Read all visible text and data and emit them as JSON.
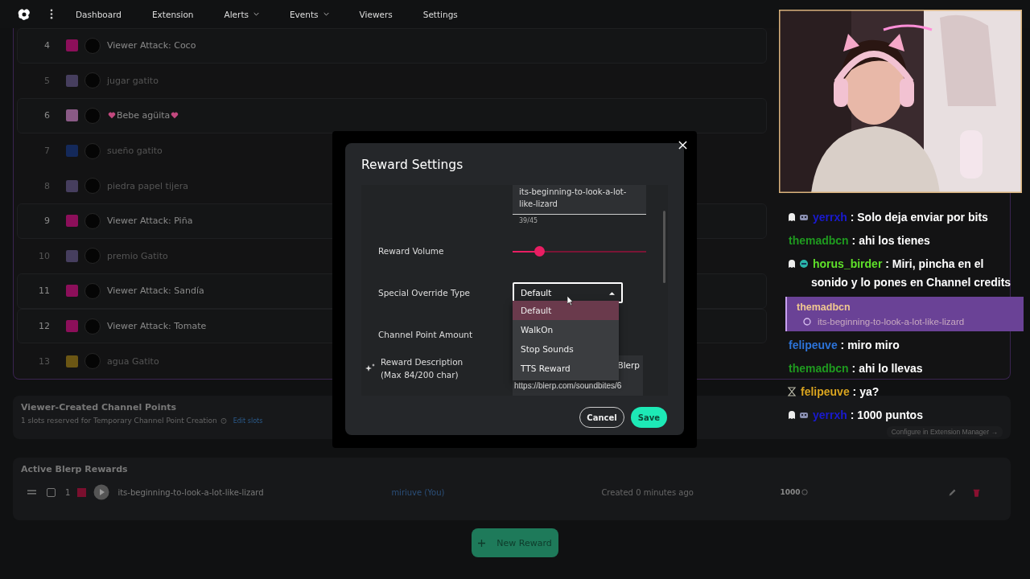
{
  "nav": {
    "items": [
      {
        "label": "Dashboard",
        "dropdown": false
      },
      {
        "label": "Extension",
        "dropdown": false
      },
      {
        "label": "Alerts",
        "dropdown": true
      },
      {
        "label": "Events",
        "dropdown": true
      },
      {
        "label": "Viewers",
        "dropdown": false
      },
      {
        "label": "Settings",
        "dropdown": false
      }
    ]
  },
  "rewards_list": {
    "rows": [
      {
        "number": "4",
        "title": "Viewer Attack: Coco",
        "color": "#8c0f5a",
        "enabled": true,
        "hearts": false
      },
      {
        "number": "5",
        "title": "jugar gatito",
        "color": "#463e5e",
        "enabled": false,
        "hearts": false
      },
      {
        "number": "6",
        "title": "Bebe agüita",
        "color": "#8a5a86",
        "enabled": true,
        "hearts": true
      },
      {
        "number": "7",
        "title": "sueño gatito",
        "color": "#14295a",
        "enabled": false,
        "hearts": false
      },
      {
        "number": "8",
        "title": "piedra papel tijera",
        "color": "#463e5e",
        "enabled": false,
        "hearts": false
      },
      {
        "number": "9",
        "title": "Viewer Attack: Piña",
        "color": "#8c0f5a",
        "enabled": true,
        "hearts": false
      },
      {
        "number": "10",
        "title": "premio Gatito",
        "color": "#463e5e",
        "enabled": false,
        "hearts": false
      },
      {
        "number": "11",
        "title": "Viewer Attack: Sandía",
        "color": "#8c0f5a",
        "enabled": true,
        "hearts": false
      },
      {
        "number": "12",
        "title": "Viewer Attack: Tomate",
        "color": "#8c0f5a",
        "enabled": true,
        "hearts": false
      },
      {
        "number": "13",
        "title": "agua Gatito",
        "color": "#6b5614",
        "enabled": false,
        "hearts": false
      }
    ]
  },
  "viewer_created": {
    "title": "Viewer-Created Channel Points",
    "description": "1 slots reserved for Temporary Channel Point Creation",
    "link": "Edit slots",
    "configure": "Configure in Extension Manager →"
  },
  "active_rewards": {
    "title": "Active Blerp Rewards",
    "rows": [
      {
        "number": "1",
        "checked": false,
        "color": "#7a0f2e",
        "title": "its-beginning-to-look-a-lot-like-lizard",
        "creator": "miriuve (You)",
        "created": "Created 0 minutes ago",
        "points": "1000"
      }
    ]
  },
  "new_reward_button": "New Reward",
  "modal": {
    "title": "Reward Settings",
    "title_value": "its-beginning-to-look-a-lot-like-lizard",
    "counter": "39/45",
    "volume_label": "Reward Volume",
    "volume": {
      "level": 0.2
    },
    "override_label": "Special Override Type",
    "override_value": "Default",
    "override_options": [
      {
        "label": "Default",
        "selected": true
      },
      {
        "label": "WalkOn",
        "selected": false
      },
      {
        "label": "Stop Sounds",
        "selected": false
      },
      {
        "label": "TTS Reward",
        "selected": false
      }
    ],
    "points_label": "Channel Point Amount",
    "description_label": "Reward Description (Max 84/200 char)",
    "description_visible": "Blerp",
    "description_url": "https://blerp.com/soundbites/6",
    "cancel": "Cancel",
    "save": "Save"
  },
  "chat": {
    "messages": [
      {
        "kind": "mod",
        "user": "yerrxh",
        "color": "#1a1ad0",
        "text": ": Solo deja enviar por bits"
      },
      {
        "kind": "plain",
        "user": "themadbcn",
        "color": "#1f9a1f",
        "text": ": ahi los tienes"
      },
      {
        "kind": "sub",
        "user": "horus_birder",
        "color": "#5fe02a",
        "text": ": Miri, pincha en el sonido y lo pones en Channel credits"
      },
      {
        "kind": "redemption",
        "user": "themadbcn",
        "color": "#f0c890",
        "text": "its-beginning-to-look-a-lot-like-lizard"
      },
      {
        "kind": "plain",
        "user": "felipeuve",
        "color": "#2c73d8",
        "text": ": miro miro"
      },
      {
        "kind": "plain",
        "user": "themadbcn",
        "color": "#1f9a1f",
        "text": ": ahi lo llevas"
      },
      {
        "kind": "vip",
        "user": "felipeuve",
        "color": "#daa520",
        "text": ": ya?"
      },
      {
        "kind": "mod",
        "user": "yerrxh",
        "color": "#1a1ad0",
        "text": ": 1000 puntos"
      }
    ]
  }
}
